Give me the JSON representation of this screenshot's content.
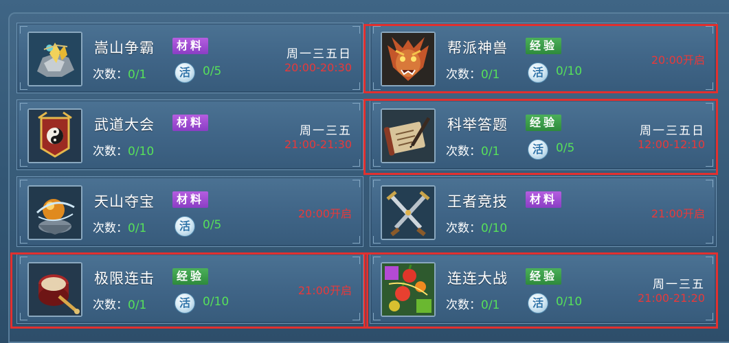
{
  "labels": {
    "count": "次数：",
    "huo": "活"
  },
  "colors": {
    "highlight": "#e2302f",
    "green_value": "#57e05a",
    "time_red": "#e8393a",
    "tag_purple": "#9a48d2",
    "tag_green": "#3a9e48"
  },
  "activities": [
    {
      "name": "嵩山争霸",
      "tag": "材料",
      "tag_type": "purple",
      "count": "0/1",
      "huo": "0/5",
      "days": "周一三五日",
      "time": "20:00-20:30",
      "icon": "crystal-ore-icon"
    },
    {
      "name": "帮派神兽",
      "tag": "经验",
      "tag_type": "green",
      "count": "0/1",
      "huo": "0/10",
      "days": "",
      "time": "20:00开启",
      "icon": "beast-mask-icon"
    },
    {
      "name": "武道大会",
      "tag": "材料",
      "tag_type": "purple",
      "count": "0/10",
      "huo": "",
      "days": "周一三五",
      "time": "21:00-21:30",
      "icon": "yin-yang-banner-icon"
    },
    {
      "name": "科举答题",
      "tag": "经验",
      "tag_type": "green",
      "count": "0/1",
      "huo": "0/5",
      "days": "周一三五日",
      "time": "12:00-12:10",
      "icon": "scroll-brush-icon"
    },
    {
      "name": "天山夺宝",
      "tag": "材料",
      "tag_type": "purple",
      "count": "0/1",
      "huo": "0/5",
      "days": "",
      "time": "20:00开启",
      "icon": "floating-orb-icon"
    },
    {
      "name": "王者竞技",
      "tag": "材料",
      "tag_type": "purple",
      "count": "0/10",
      "huo": "",
      "days": "",
      "time": "21:00开启",
      "icon": "crossed-swords-icon"
    },
    {
      "name": "极限连击",
      "tag": "经验",
      "tag_type": "green",
      "count": "0/1",
      "huo": "0/10",
      "days": "",
      "time": "21:00开启",
      "icon": "drum-icon"
    },
    {
      "name": "连连大战",
      "tag": "经验",
      "tag_type": "green",
      "count": "0/1",
      "huo": "0/10",
      "days": "周一三五",
      "time": "21:00-21:20",
      "icon": "fruit-match-icon"
    }
  ],
  "highlighted": [
    "帮派神兽",
    "科举答题",
    "极限连击",
    "连连大战"
  ]
}
